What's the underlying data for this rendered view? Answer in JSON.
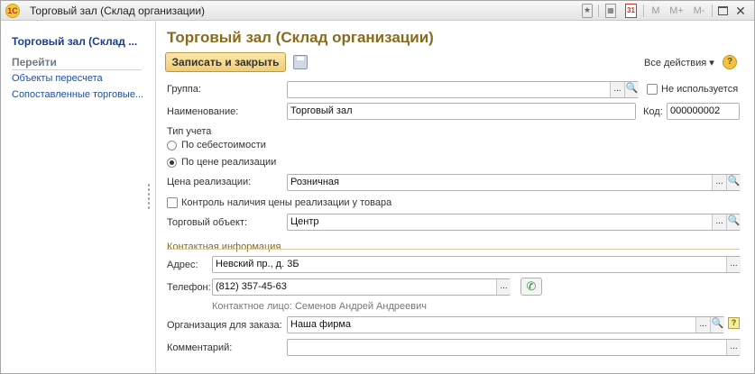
{
  "window": {
    "title": "Торговый зал (Склад организации)",
    "app_icon": "1C",
    "toolbar_icons": [
      "bookmark-star-icon",
      "calculator-icon",
      "calendar-icon"
    ],
    "calendar_day": "31",
    "memory_buttons": [
      "M",
      "M+",
      "M-"
    ]
  },
  "nav": {
    "title": "Торговый зал (Склад ...",
    "section": "Перейти",
    "links": [
      "Объекты пересчета",
      "Сопоставленные торговые..."
    ]
  },
  "form": {
    "heading": "Торговый зал (Склад организации)",
    "save_close_label": "Записать и закрыть",
    "all_actions_label": "Все действия",
    "help_label": "?",
    "group_label": "Группа:",
    "group_value": "",
    "not_used_label": "Не используется",
    "name_label": "Наименование:",
    "name_value": "Торговый зал",
    "code_label": "Код:",
    "code_value": "000000002",
    "accounting_type_label": "Тип учета",
    "radio_cost_label": "По себестоимости",
    "radio_price_label": "По цене реализации",
    "price_label": "Цена реализации:",
    "price_value": "Розничная",
    "price_control_label": "Контроль наличия цены реализации у товара",
    "trade_object_label": "Торговый объект:",
    "trade_object_value": "Центр",
    "contact_section_label": "Контактная информация",
    "address_label": "Адрес:",
    "address_value": "Невский пр., д. 3Б",
    "phone_label": "Телефон:",
    "phone_value": "(812) 357-45-63",
    "contact_person_text": "Контактное лицо: Семенов Андрей Андреевич",
    "order_org_label": "Организация для заказа:",
    "order_org_value": "Наша фирма",
    "order_help_label": "?",
    "comment_label": "Комментарий:",
    "comment_value": ""
  },
  "glyphs": {
    "ellipsis": "...",
    "search_icon": "🔍",
    "phone_icon": "✆",
    "dropdown_arrow": "▾"
  },
  "colors": {
    "heading": "#8a6a1d",
    "nav_link": "#1e4fa3",
    "primary_button": "#efcd73"
  }
}
